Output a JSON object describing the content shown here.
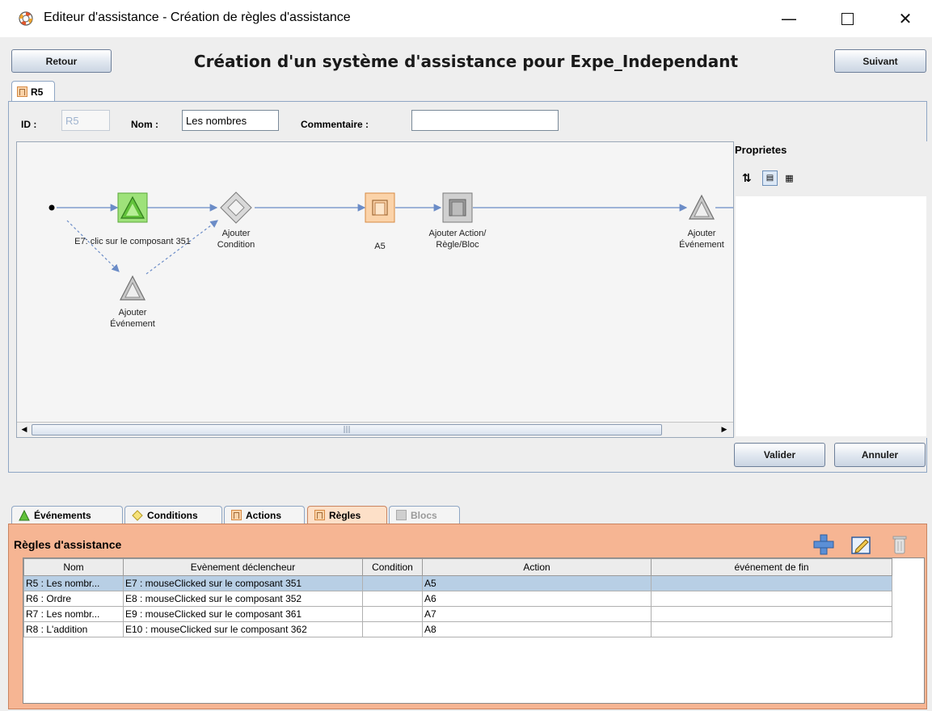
{
  "window": {
    "title": "Editeur d'assistance - Création de règles d'assistance"
  },
  "header": {
    "back_label": "Retour",
    "next_label": "Suivant",
    "heading": "Création d'un système d'assistance pour Expe_Independant"
  },
  "rule_tab": {
    "label": "R5"
  },
  "form": {
    "id_label": "ID :",
    "id_value": "R5",
    "name_label": "Nom :",
    "name_value": "Les nombres",
    "comment_label": "Commentaire :",
    "comment_value": ""
  },
  "diagram": {
    "nodes": {
      "event_e7": "E7: clic sur le composant 351",
      "add_condition_1": "Ajouter",
      "add_condition_2": "Condition",
      "action_a5": "A5",
      "add_action_1": "Ajouter Action/",
      "add_action_2": "Règle/Bloc",
      "add_event_end_1": "Ajouter",
      "add_event_end_2": "Événement",
      "add_event_alt_1": "Ajouter",
      "add_event_alt_2": "Événement"
    }
  },
  "properties": {
    "title": "Proprietes"
  },
  "editor_buttons": {
    "validate": "Valider",
    "cancel": "Annuler"
  },
  "bottom_tabs": [
    {
      "label": "Événements",
      "icon": "event-icon",
      "enabled": true
    },
    {
      "label": "Conditions",
      "icon": "condition-icon",
      "enabled": true
    },
    {
      "label": "Actions",
      "icon": "action-icon",
      "enabled": true
    },
    {
      "label": "Règles",
      "icon": "rule-icon",
      "enabled": true,
      "selected": true
    },
    {
      "label": "Blocs",
      "icon": "block-icon",
      "enabled": false
    }
  ],
  "rules_panel": {
    "title": "Règles d'assistance",
    "columns": [
      "Nom",
      "Evènement déclencheur",
      "Condition",
      "Action",
      "événement de fin"
    ],
    "rows": [
      {
        "nom": "R5 : Les nombr...",
        "event": "E7 : mouseClicked sur le composant 351",
        "condition": "",
        "action": "A5",
        "end_event": "",
        "selected": true
      },
      {
        "nom": "R6 : Ordre",
        "event": "E8 : mouseClicked sur le composant 352",
        "condition": "",
        "action": "A6",
        "end_event": ""
      },
      {
        "nom": "R7 : Les nombr...",
        "event": "E9 : mouseClicked sur le composant 361",
        "condition": "",
        "action": "A7",
        "end_event": ""
      },
      {
        "nom": "R8 : L'addition",
        "event": "E10 : mouseClicked sur le composant 362",
        "condition": "",
        "action": "A8",
        "end_event": ""
      }
    ]
  },
  "colors": {
    "rules_panel_bg": "#f6b593",
    "selection": "#b8cfe5",
    "event_green": "#7ccf4e",
    "action_orange": "#fbd3a9",
    "edge_blue": "#6b8cc7"
  }
}
